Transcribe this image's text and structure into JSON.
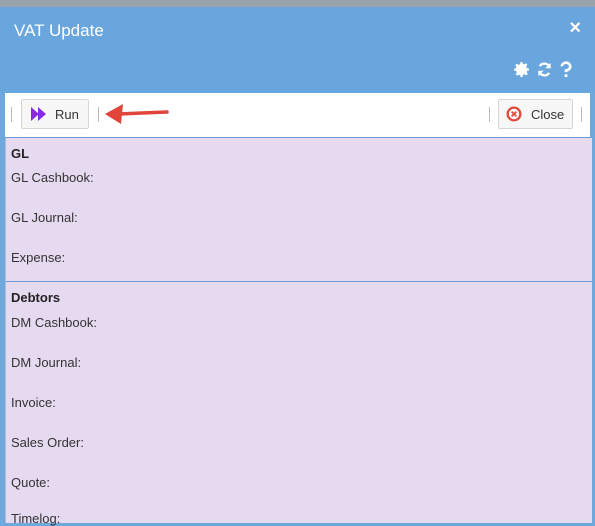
{
  "window": {
    "title": "VAT Update",
    "close_glyph": "×"
  },
  "header_tools": [
    {
      "name": "settings-icon"
    },
    {
      "name": "refresh-icon"
    },
    {
      "name": "help-icon"
    }
  ],
  "toolbar": {
    "run_label": "Run",
    "close_label": "Close"
  },
  "gl": {
    "heading": "GL",
    "fields": [
      "GL Cashbook:",
      "GL Journal:",
      "Expense:"
    ]
  },
  "debtors": {
    "heading": "Debtors",
    "fields": [
      "DM Cashbook:",
      "DM Journal:",
      "Invoice:",
      "Sales Order:",
      "Quote:",
      "Timelog:"
    ]
  },
  "colors": {
    "accent": "#6aa6de",
    "panel": "#e6daf0",
    "arrow": "#e0443a",
    "run_icon": "#8a2be2",
    "close_icon": "#e04a3a"
  }
}
